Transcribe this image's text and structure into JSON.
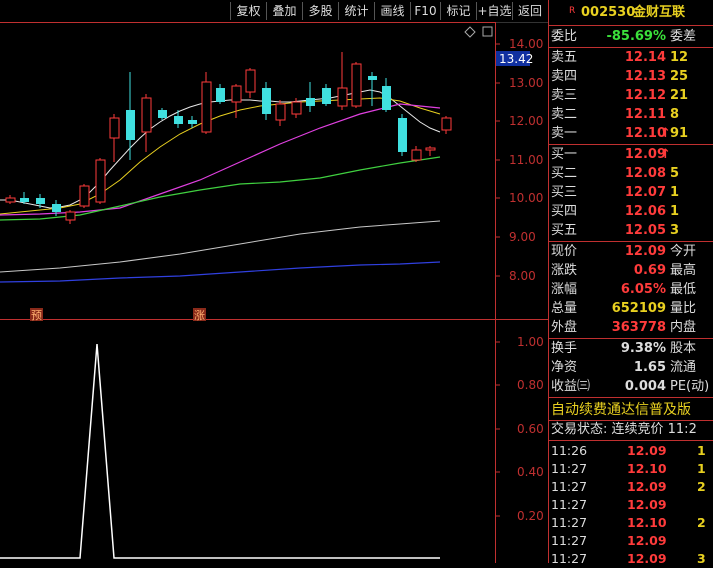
{
  "toolbar": {
    "buttons": [
      "复权",
      "叠加",
      "多股",
      "统计",
      "画线",
      "F10",
      "标记",
      "+自选",
      "返回"
    ]
  },
  "stock": {
    "flag": "R",
    "code": "002530",
    "name": "金财互联"
  },
  "chart": {
    "price_axis_ticks": [
      "14.00",
      "13.00",
      "12.00",
      "11.00",
      "10.00",
      "9.00",
      "8.00"
    ],
    "current_price_tag": "13.42",
    "marker_yu": "预",
    "marker_zhang": "涨",
    "indicator_axis_ticks": [
      "1.00",
      "0.80",
      "0.60",
      "0.40",
      "0.20"
    ],
    "diamond_icon": "diamond-icon",
    "scroll_icon": "square-icon"
  },
  "weibi": {
    "label": "委比",
    "value": "-85.69%",
    "label2": "委差"
  },
  "asks": [
    {
      "label": "卖五",
      "price": "12.14",
      "vol": "12"
    },
    {
      "label": "卖四",
      "price": "12.13",
      "vol": "25"
    },
    {
      "label": "卖三",
      "price": "12.12",
      "vol": "21"
    },
    {
      "label": "卖二",
      "price": "12.11",
      "vol": "8"
    },
    {
      "label": "卖一",
      "price": "12.10",
      "vol": "91",
      "arrow": "↑"
    }
  ],
  "bids": [
    {
      "label": "买一",
      "price": "12.09",
      "vol": "",
      "arrow": "↑"
    },
    {
      "label": "买二",
      "price": "12.08",
      "vol": "5"
    },
    {
      "label": "买三",
      "price": "12.07",
      "vol": "1"
    },
    {
      "label": "买四",
      "price": "12.06",
      "vol": "1"
    },
    {
      "label": "买五",
      "price": "12.05",
      "vol": "3"
    }
  ],
  "quote": [
    {
      "label": "现价",
      "value": "12.09",
      "label2": "今开"
    },
    {
      "label": "涨跌",
      "value": "0.69",
      "label2": "最高"
    },
    {
      "label": "涨幅",
      "value": "6.05%",
      "label2": "最低"
    },
    {
      "label": "总量",
      "value": "652109",
      "label2": "量比"
    },
    {
      "label": "外盘",
      "value": "363778",
      "label2": "内盘"
    }
  ],
  "fundamentals": [
    {
      "label": "换手",
      "value": "9.38%",
      "label2": "股本"
    },
    {
      "label": "净资",
      "value": "1.65",
      "label2": "流通"
    },
    {
      "label": "收益㈢",
      "value": "0.004",
      "label2": "PE(动)"
    }
  ],
  "banner": "自动续费通达信普及版",
  "trade_status": "交易状态: 连续竞价 11:2",
  "ticks": [
    {
      "time": "11:26",
      "price": "12.09",
      "vol": "1"
    },
    {
      "time": "11:27",
      "price": "12.10",
      "vol": "1"
    },
    {
      "time": "11:27",
      "price": "12.09",
      "vol": "2"
    },
    {
      "time": "11:27",
      "price": "12.09",
      "vol": ""
    },
    {
      "time": "11:27",
      "price": "12.10",
      "vol": "2"
    },
    {
      "time": "11:27",
      "price": "12.09",
      "vol": ""
    },
    {
      "time": "11:27",
      "price": "12.09",
      "vol": "3"
    }
  ]
}
